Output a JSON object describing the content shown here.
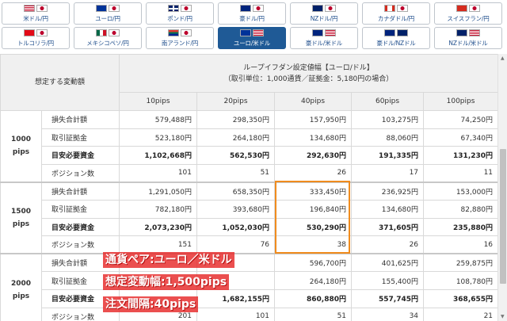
{
  "tabs": [
    {
      "label": "米ドル/円",
      "flags": [
        "us",
        "jp"
      ],
      "active": false
    },
    {
      "label": "ユーロ/円",
      "flags": [
        "eu",
        "jp"
      ],
      "active": false
    },
    {
      "label": "ポンド/円",
      "flags": [
        "gb",
        "jp"
      ],
      "active": false
    },
    {
      "label": "豪ドル/円",
      "flags": [
        "au",
        "jp"
      ],
      "active": false
    },
    {
      "label": "NZドル/円",
      "flags": [
        "nz",
        "jp"
      ],
      "active": false
    },
    {
      "label": "カナダドル/円",
      "flags": [
        "ca",
        "jp"
      ],
      "active": false
    },
    {
      "label": "スイスフラン/円",
      "flags": [
        "ch",
        "jp"
      ],
      "active": false
    },
    {
      "label": "トルコリラ/円",
      "flags": [
        "tr",
        "jp"
      ],
      "active": false
    },
    {
      "label": "メキシコペソ/円",
      "flags": [
        "mx",
        "jp"
      ],
      "active": false
    },
    {
      "label": "南アランド/円",
      "flags": [
        "za",
        "jp"
      ],
      "active": false
    },
    {
      "label": "ユーロ/米ドル",
      "flags": [
        "eu",
        "us"
      ],
      "active": true
    },
    {
      "label": "豪ドル/米ドル",
      "flags": [
        "au",
        "us"
      ],
      "active": false
    },
    {
      "label": "豪ドル/NZドル",
      "flags": [
        "au",
        "nz"
      ],
      "active": false
    },
    {
      "label": "NZドル/米ドル",
      "flags": [
        "nz",
        "us"
      ],
      "active": false
    }
  ],
  "table": {
    "row_header": "想定する変動額",
    "title_line1": "ループイフダン設定値幅【ユーロ/ドル】",
    "title_line2": "（取引単位：1,000通貨／証拠金：5,180円の場合）",
    "pips_columns": [
      "10pips",
      "20pips",
      "40pips",
      "60pips",
      "100pips"
    ],
    "groups": [
      {
        "range": "1000\npips",
        "rows": [
          {
            "label": "損失合計額",
            "bold": false,
            "values": [
              "579,488円",
              "298,350円",
              "157,950円",
              "103,275円",
              "74,250円"
            ]
          },
          {
            "label": "取引証拠金",
            "bold": false,
            "values": [
              "523,180円",
              "264,180円",
              "134,680円",
              "88,060円",
              "67,340円"
            ]
          },
          {
            "label": "目安必要資金",
            "bold": true,
            "values": [
              "1,102,668円",
              "562,530円",
              "292,630円",
              "191,335円",
              "131,230円"
            ]
          },
          {
            "label": "ポジション数",
            "bold": false,
            "values": [
              "101",
              "51",
              "26",
              "17",
              "11"
            ]
          }
        ]
      },
      {
        "range": "1500\npips",
        "rows": [
          {
            "label": "損失合計額",
            "bold": false,
            "values": [
              "1,291,050円",
              "658,350円",
              "333,450円",
              "236,925円",
              "153,000円"
            ]
          },
          {
            "label": "取引証拠金",
            "bold": false,
            "values": [
              "782,180円",
              "393,680円",
              "196,840円",
              "134,680円",
              "82,880円"
            ]
          },
          {
            "label": "目安必要資金",
            "bold": true,
            "values": [
              "2,073,230円",
              "1,052,030円",
              "530,290円",
              "371,605円",
              "235,880円"
            ]
          },
          {
            "label": "ポジション数",
            "bold": false,
            "values": [
              "151",
              "76",
              "38",
              "26",
              "16"
            ]
          }
        ]
      },
      {
        "range": "2000\npips",
        "rows": [
          {
            "label": "損失合計額",
            "bold": false,
            "values": [
              "",
              "",
              "596,700円",
              "401,625円",
              "259,875円"
            ]
          },
          {
            "label": "取引証拠金",
            "bold": false,
            "values": [
              "",
              "",
              "264,180円",
              "155,400円",
              "108,780円"
            ]
          },
          {
            "label": "目安必要資金",
            "bold": true,
            "values": [
              "",
              "1,682,155円",
              "860,880円",
              "557,745円",
              "368,655円"
            ]
          },
          {
            "label": "ポジション数",
            "bold": false,
            "values": [
              "201",
              "101",
              "51",
              "34",
              "21"
            ]
          }
        ]
      }
    ]
  },
  "captions": [
    "通貨ペア:ユーロ／米ドル",
    "想定変動幅:1,500pips",
    "注文間隔:40pips"
  ],
  "colors": {
    "active_tab": "#1f5a96",
    "tab_label": "#1f4e8c",
    "highlight": "#f08c1e",
    "caption_bg": "#e62828"
  }
}
